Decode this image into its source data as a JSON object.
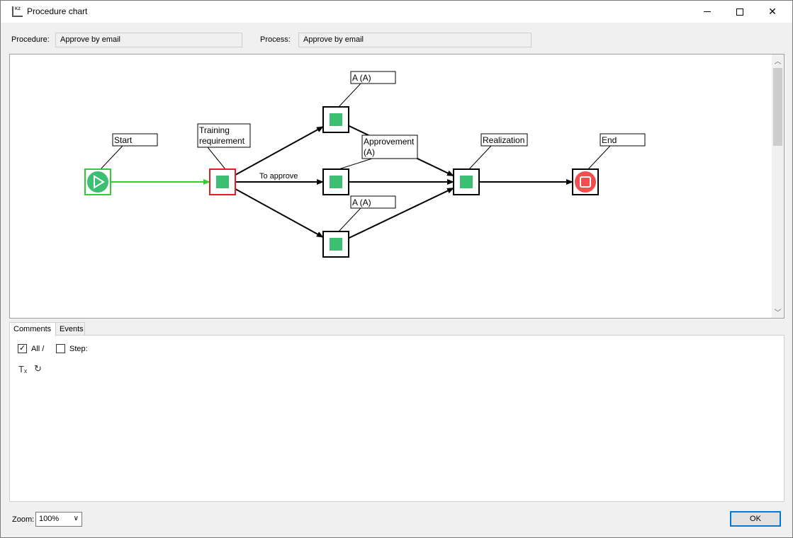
{
  "window": {
    "title": "Procedure chart",
    "close_glyph": "✕"
  },
  "header": {
    "procedure_label": "Procedure:",
    "procedure_value": "Approve by email",
    "process_label": "Process:",
    "process_value": "Approve by email"
  },
  "diagram": {
    "nodes": [
      {
        "id": "start",
        "label": "Start",
        "kind": "start"
      },
      {
        "id": "training",
        "label": "Training requirement",
        "kind": "step-active"
      },
      {
        "id": "a_top",
        "label": "A (A)",
        "kind": "step"
      },
      {
        "id": "approvement",
        "label": "Approvement (A)",
        "kind": "step"
      },
      {
        "id": "a_bottom",
        "label": "A (A)",
        "kind": "step"
      },
      {
        "id": "realization",
        "label": "Realization",
        "kind": "step"
      },
      {
        "id": "end",
        "label": "End",
        "kind": "end"
      }
    ],
    "edges": [
      {
        "from": "start",
        "to": "training",
        "label": "",
        "color": "#33cc33"
      },
      {
        "from": "training",
        "to": "a_top",
        "label": "",
        "color": "#000000"
      },
      {
        "from": "training",
        "to": "approvement",
        "label": "To approve",
        "color": "#000000"
      },
      {
        "from": "training",
        "to": "a_bottom",
        "label": "",
        "color": "#000000"
      },
      {
        "from": "a_top",
        "to": "realization",
        "label": "",
        "color": "#000000"
      },
      {
        "from": "approvement",
        "to": "realization",
        "label": "",
        "color": "#000000"
      },
      {
        "from": "a_bottom",
        "to": "realization",
        "label": "",
        "color": "#000000"
      },
      {
        "from": "realization",
        "to": "end",
        "label": "",
        "color": "#000000"
      }
    ],
    "colors": {
      "step_fill": "#3dbf73",
      "start_fill": "#3dbf73",
      "end_fill": "#f0504d",
      "active_border": "#e02020",
      "start_border": "#33cc33"
    }
  },
  "tabs": [
    {
      "label": "Comments",
      "active": true
    },
    {
      "label": "Events",
      "active": false
    }
  ],
  "comments": {
    "all_label": "All /",
    "all_checked": true,
    "step_label": "Step:",
    "step_checked": false,
    "clear_format_icon": "Tₓ",
    "refresh_icon": "↻",
    "check_glyph": "✓"
  },
  "footer": {
    "zoom_label": "Zoom:",
    "zoom_value": "100%",
    "ok_label": "OK"
  }
}
